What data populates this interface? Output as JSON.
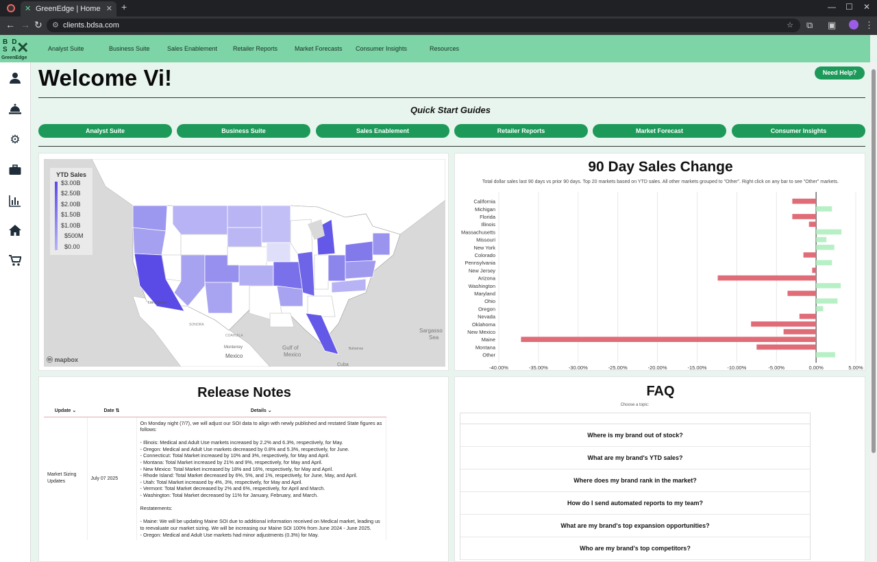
{
  "browser": {
    "tab_title": "GreenEdge | Home",
    "url": "clients.bdsa.com"
  },
  "nav": {
    "logo_line1": "BD",
    "logo_line2": "SA",
    "logo_sub": "GreenEdge",
    "items": [
      "Analyst Suite",
      "Business Suite",
      "Sales Enablement",
      "Retailer Reports",
      "Market Forecasts",
      "Consumer Insights",
      "Resources"
    ]
  },
  "sidebar": {
    "icons": [
      "user-icon",
      "reception-bell-icon",
      "gear-icon",
      "briefcase-icon",
      "bar-chart-icon",
      "home-icon",
      "shopping-cart-icon"
    ]
  },
  "welcome": "Welcome Vi!",
  "help_button": "Need Help?",
  "quick_start": {
    "title": "Quick Start Guides",
    "buttons": [
      "Analyst Suite",
      "Business Suite",
      "Sales Enablement",
      "Retailer Reports",
      "Market Forecast",
      "Consumer Insights"
    ]
  },
  "map": {
    "legend_title": "YTD Sales",
    "legend_values": [
      "$3.00B",
      "$2.50B",
      "$2.00B",
      "$1.50B",
      "$1.00B",
      "$500M",
      "$0.00"
    ],
    "labels": [
      "Gulf of Mexico",
      "Sargasso Sea",
      "Mexico",
      "Monterrey",
      "Cuba",
      "Bahamas",
      "SONORA",
      "COAHUILA",
      "Los Angeles"
    ],
    "attribution": "mapbox"
  },
  "chart_data": {
    "type": "bar",
    "orientation": "horizontal",
    "title": "90 Day Sales Change",
    "subtitle": "Total dollar sales last 90 days vs prior 90 days. Top 20 markets based on YTD sales. All other markets grouped to \"Other\". Right click on any bar to see \"Other\" markets.",
    "categories": [
      "California",
      "Michigan",
      "Florida",
      "Illinois",
      "Massachusetts",
      "Missouri",
      "New York",
      "Colorado",
      "Pennsylvania",
      "New Jersey",
      "Arizona",
      "Washington",
      "Maryland",
      "Ohio",
      "Oregon",
      "Nevada",
      "Oklahoma",
      "New Mexico",
      "Maine",
      "Montana",
      "Other"
    ],
    "values": [
      -3.0,
      2.0,
      -3.0,
      -0.9,
      3.2,
      1.3,
      2.3,
      -1.6,
      2.0,
      -0.5,
      -12.4,
      3.1,
      -3.6,
      2.7,
      0.9,
      -2.1,
      -8.2,
      -4.1,
      -37.2,
      -7.5,
      2.4
    ],
    "xticks": [
      "-40.00%",
      "-35.00%",
      "-30.00%",
      "-25.00%",
      "-20.00%",
      "-15.00%",
      "-10.00%",
      "-5.00%",
      "0.00%",
      "5.00%"
    ],
    "xlim": [
      -40,
      5
    ],
    "positive_color": "#b8f0c6",
    "negative_color": "#e06c78"
  },
  "release_notes": {
    "title": "Release Notes",
    "columns": [
      "Update",
      "Date",
      "Details"
    ],
    "rows": [
      {
        "update": "Market Sizing Updates",
        "date": "July 07 2025",
        "details": "On Monday night (7/7), we will adjust our SOI data to align with newly published and restated State figures as follows:\n\n- Illinois: Medical and Adult Use markets increased by 2.2% and 6.3%, respectively, for May.\n- Oregon: Medical and Adult Use markets decreased by 0.8% and 5.3%, respectively, for June.\n- Connecticut: Total Market increased by 10% and 3%, respectively, for May and April.\n- Montana: Total Market increased by 21% and 9%, respectively, for May and April.\n- New Mexico: Total Market increased by 18% and 16%, respectively, for May and April.\n- Rhode Island: Total Market decreased by 6%, 5%, and 1%, respectively, for June, May, and April.\n- Utah: Total Market increased by 4%, 3%, respectively, for May and April.\n- Vermont: Total Market decreased by 2% and 6%, respectively, for April and March.\n- Washington: Total Market decreased by 11% for January, February, and March.\n\nRestatements:\n\n- Maine: We will be updating Maine SOI due to additional information received on Medical market, leading us to reevaluate our market sizing. We will be increasing our Maine SOI 100% from June 2024 - June 2025.\n- Oregon: Medical and Adult Use markets had minor adjustments (0.3%) for May."
      }
    ]
  },
  "faq": {
    "title": "FAQ",
    "subtitle": "Choose a topic:",
    "items": [
      "Where is my brand out of stock?",
      "What are my brand's YTD sales?",
      "Where does my brand rank in the market?",
      "How do I send automated reports to my team?",
      "What are my brand's top expansion opportunities?",
      "Who are my brand's top competitors?"
    ]
  }
}
